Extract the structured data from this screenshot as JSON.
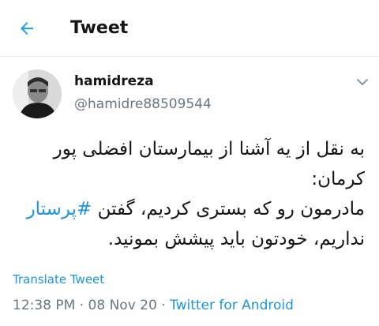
{
  "header": {
    "title": "Tweet",
    "back_icon": "arrow-left-icon",
    "accent_color": "#1da1f2"
  },
  "tweet": {
    "author": {
      "display_name": "hamidreza",
      "handle": "@hamidre88509544",
      "avatar": "avatar"
    },
    "menu_icon": "chevron-down-icon",
    "text": {
      "line1": "به نقل از یه آشنا از بیمارستان افضلی پور",
      "line2": "کرمان:",
      "line3_before": "مادرمون رو که بستری کردیم، گفتن ",
      "hashtag": "#پرستار",
      "line4": "نداریم، خودتون باید پیشش بمونید."
    },
    "translate_label": "Translate Tweet",
    "time": "12:38 PM",
    "date": "08 Nov 20",
    "separator": "·",
    "source": "Twitter for Android",
    "link_color": "#1b95e0"
  }
}
